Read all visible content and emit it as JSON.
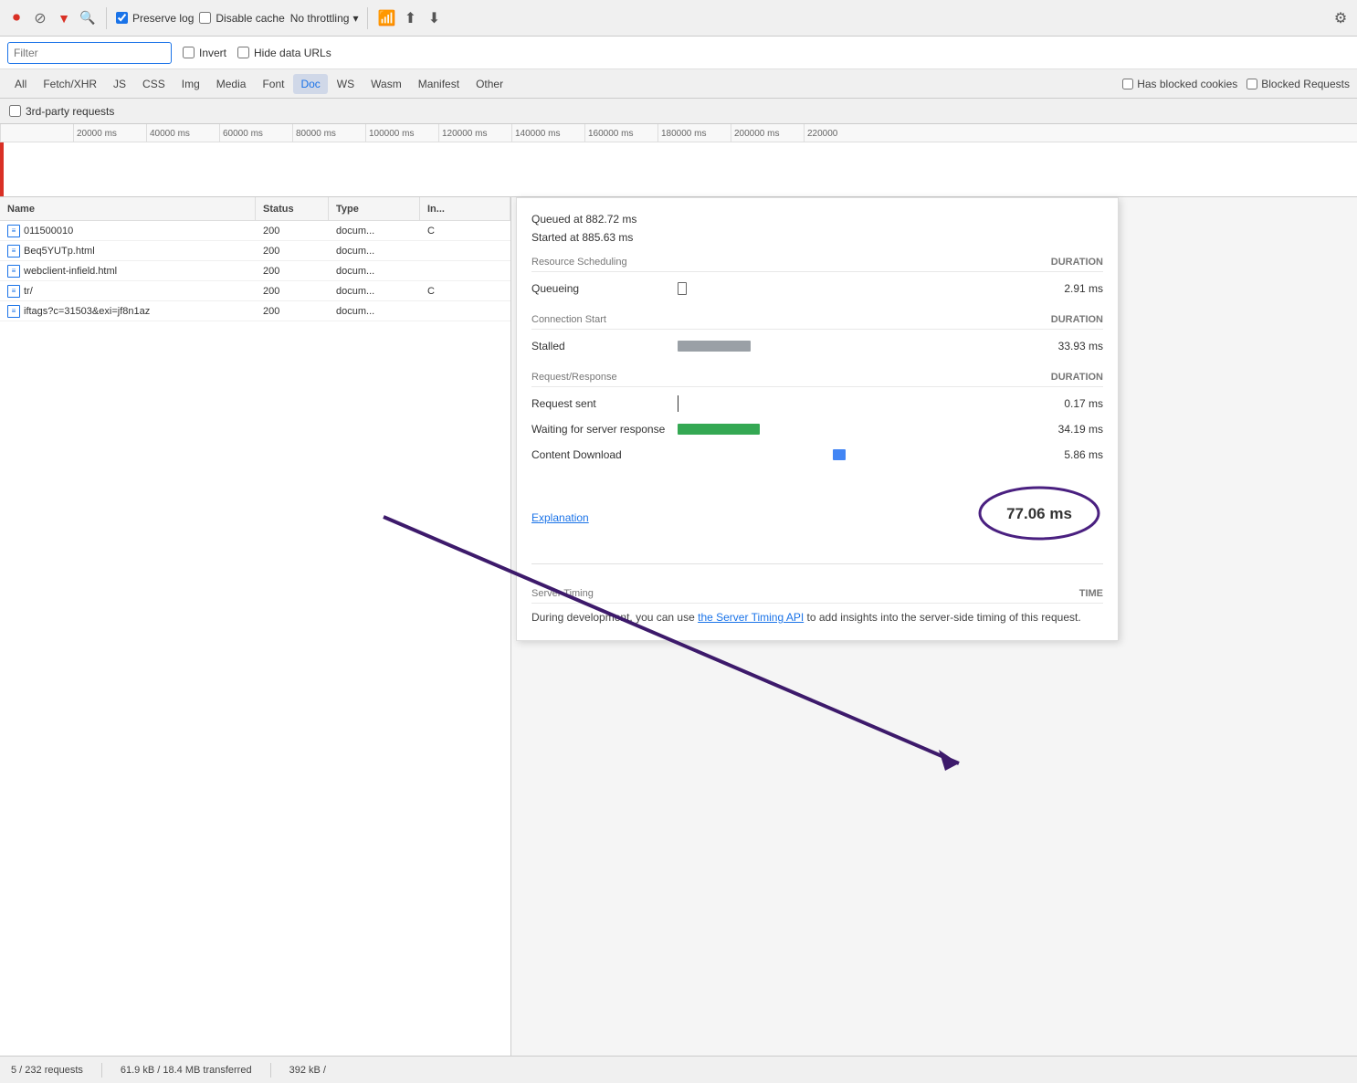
{
  "toolbar": {
    "preserve_log_label": "Preserve log",
    "disable_cache_label": "Disable cache",
    "throttle_label": "No throttling"
  },
  "filter_bar": {
    "filter_placeholder": "Filter",
    "invert_label": "Invert",
    "hide_data_urls_label": "Hide data URLs"
  },
  "tabs": [
    {
      "id": "all",
      "label": "All"
    },
    {
      "id": "fetch-xhr",
      "label": "Fetch/XHR"
    },
    {
      "id": "js",
      "label": "JS"
    },
    {
      "id": "css",
      "label": "CSS"
    },
    {
      "id": "img",
      "label": "Img"
    },
    {
      "id": "media",
      "label": "Media"
    },
    {
      "id": "font",
      "label": "Font"
    },
    {
      "id": "doc",
      "label": "Doc",
      "active": true
    },
    {
      "id": "ws",
      "label": "WS"
    },
    {
      "id": "wasm",
      "label": "Wasm"
    },
    {
      "id": "manifest",
      "label": "Manifest"
    },
    {
      "id": "other",
      "label": "Other"
    }
  ],
  "tab_filters": {
    "has_blocked_cookies": "Has blocked cookies",
    "blocked_requests": "Blocked Requests"
  },
  "third_party": {
    "label": "3rd-party requests"
  },
  "timeline": {
    "marks": [
      "20000 ms",
      "40000 ms",
      "60000 ms",
      "80000 ms",
      "100000 ms",
      "120000 ms",
      "140000 ms",
      "160000 ms",
      "180000 ms",
      "200000 ms",
      "220000"
    ]
  },
  "table_headers": {
    "name": "Name",
    "status": "Status",
    "type": "Type",
    "initiator": "In..."
  },
  "rows": [
    {
      "name": "011500010",
      "status": "200",
      "type": "docum...",
      "init": "C"
    },
    {
      "name": "Beq5YUTp.html",
      "status": "200",
      "type": "docum...",
      "init": ""
    },
    {
      "name": "webclient-infield.html",
      "status": "200",
      "type": "docum...",
      "init": ""
    },
    {
      "name": "tr/",
      "status": "200",
      "type": "docum...",
      "init": "C"
    },
    {
      "name": "iftags?c=31503&exi=jf8n1az",
      "status": "200",
      "type": "docum...",
      "init": ""
    }
  ],
  "timing_panel": {
    "queued_at": "Queued at 882.72 ms",
    "started_at": "Started at 885.63 ms",
    "resource_scheduling": {
      "section_title": "Resource Scheduling",
      "duration_label": "DURATION",
      "rows": [
        {
          "label": "Queueing",
          "bar_type": "outline",
          "value": "2.91 ms"
        }
      ]
    },
    "connection_start": {
      "section_title": "Connection Start",
      "duration_label": "DURATION",
      "rows": [
        {
          "label": "Stalled",
          "bar_type": "gray",
          "value": "33.93 ms"
        }
      ]
    },
    "request_response": {
      "section_title": "Request/Response",
      "duration_label": "DURATION",
      "rows": [
        {
          "label": "Request sent",
          "bar_type": "line",
          "value": "0.17 ms"
        },
        {
          "label": "Waiting for server response",
          "bar_type": "green",
          "value": "34.19 ms"
        },
        {
          "label": "Content Download",
          "bar_type": "blue",
          "value": "5.86 ms"
        }
      ]
    },
    "explanation_link": "Explanation",
    "total_time": "77.06 ms",
    "server_timing": {
      "section_title": "Server Timing",
      "time_label": "TIME",
      "description": "During development, you can use ",
      "link_text": "the Server Timing API",
      "description_end": " to add insights into the server-side timing of this request."
    }
  },
  "status_bar": {
    "requests": "5 / 232 requests",
    "transferred": "61.9 kB / 18.4 MB transferred",
    "resources": "392 kB /"
  }
}
